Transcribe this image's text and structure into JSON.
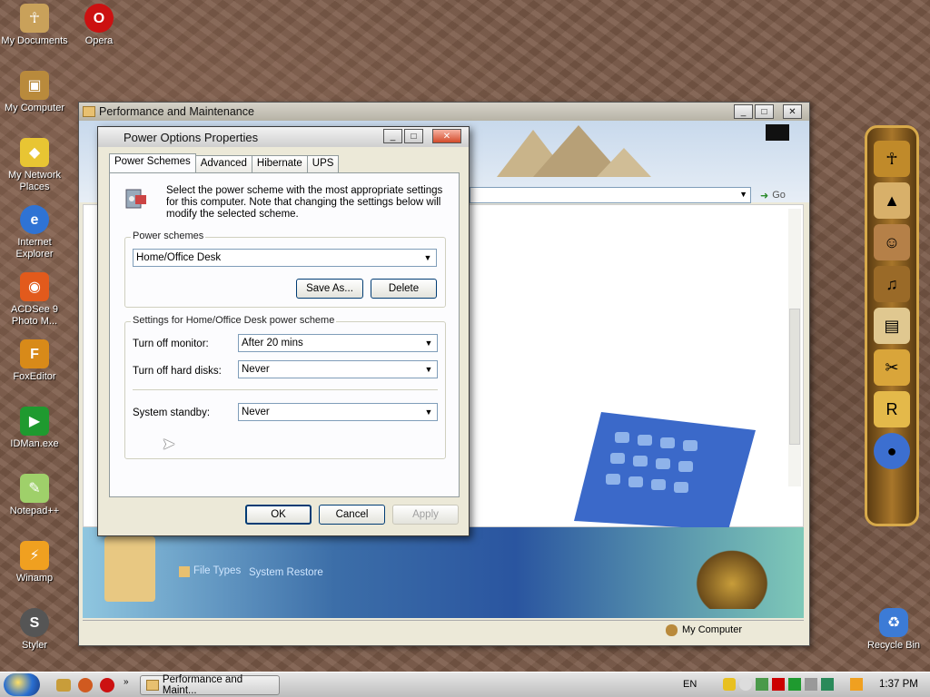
{
  "desktop": {
    "icons": [
      {
        "label": "My Documents",
        "icon": "user-folder-icon",
        "color": "#c9a15a"
      },
      {
        "label": "Opera",
        "icon": "opera-icon",
        "color": "#cc1111"
      },
      {
        "label": "My Computer",
        "icon": "computer-icon",
        "color": "#b98a3c"
      },
      {
        "label": "My Network Places",
        "icon": "network-icon",
        "color": "#e8c533"
      },
      {
        "label": "Internet Explorer",
        "icon": "ie-icon",
        "color": "#2f73d4"
      },
      {
        "label": "ACDSee 9 Photo M...",
        "icon": "camera-icon",
        "color": "#e25a1c"
      },
      {
        "label": "FoxEditor",
        "icon": "foxeditor-icon",
        "color": "#d88a19"
      },
      {
        "label": "IDMan.exe",
        "icon": "idm-icon",
        "color": "#1f9a2f"
      },
      {
        "label": "Notepad++",
        "icon": "notepad-icon",
        "color": "#9fd06a"
      },
      {
        "label": "Winamp",
        "icon": "winamp-icon",
        "color": "#f0a020"
      },
      {
        "label": "Styler",
        "icon": "styler-icon",
        "color": "#555555"
      },
      {
        "label": "Recycle Bin",
        "icon": "recycle-bin-icon",
        "color": "#3c7bd6"
      }
    ]
  },
  "background_window": {
    "title": "Performance and Maintenance",
    "go_label": "Go",
    "status_location": "My Computer",
    "links": [
      "File Types",
      "System Restore"
    ]
  },
  "dialog": {
    "title": "Power Options Properties",
    "tabs": [
      "Power Schemes",
      "Advanced",
      "Hibernate",
      "UPS"
    ],
    "active_tab": "Power Schemes",
    "description": "Select the power scheme with the most appropriate settings for this computer. Note that changing the settings below will modify the selected scheme.",
    "schemes_group_label": "Power schemes",
    "selected_scheme": "Home/Office Desk",
    "save_as_label": "Save As...",
    "delete_label": "Delete",
    "settings_group_label": "Settings for Home/Office Desk power scheme",
    "monitor_label": "Turn off monitor:",
    "monitor_value": "After 20 mins",
    "harddisk_label": "Turn off hard disks:",
    "harddisk_value": "Never",
    "standby_label": "System standby:",
    "standby_value": "Never",
    "ok_label": "OK",
    "cancel_label": "Cancel",
    "apply_label": "Apply"
  },
  "taskbar": {
    "task_label": "Performance and Maint...",
    "language": "EN",
    "clock": "1:37 PM"
  }
}
